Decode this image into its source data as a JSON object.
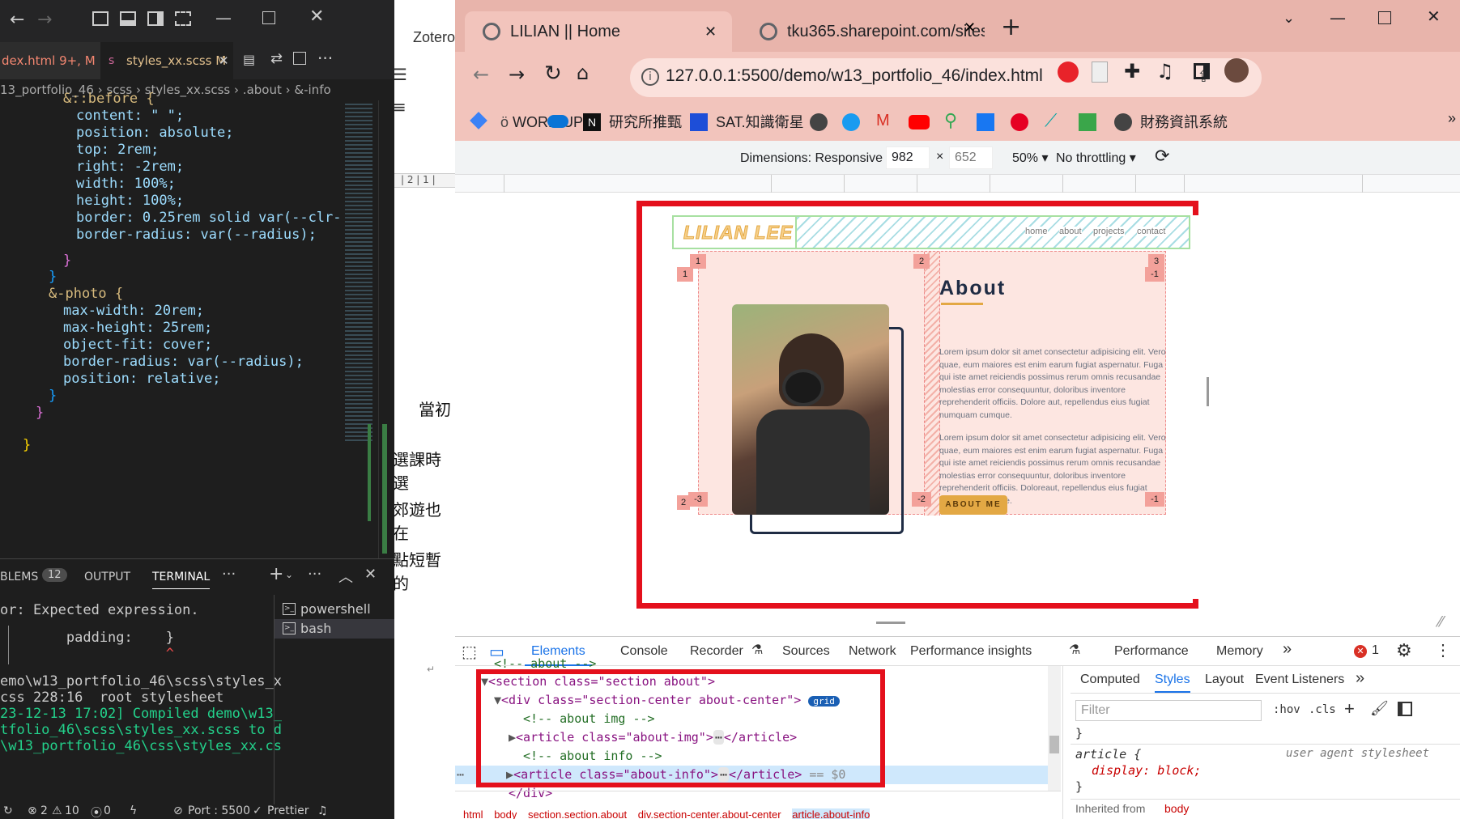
{
  "vscode": {
    "tabs": [
      {
        "label": "dex.html 9+, M"
      },
      {
        "label": "styles_xx.scss M"
      }
    ],
    "breadcrumb": {
      "parts": [
        "13_portfolio_46",
        "scss",
        "styles_xx.scss",
        ".about",
        "&-info"
      ]
    },
    "code_lines": [
      "&::before {",
      "content: \" \";",
      "position: absolute;",
      "top: 2rem;",
      "right: -2rem;",
      "width: 100%;",
      "height: 100%;",
      "border: 0.25rem solid var(--clr-",
      "border-radius: var(--radius);",
      "",
      "}",
      "}",
      "&-photo {",
      "max-width: 20rem;",
      "max-height: 25rem;",
      "object-fit: cover;",
      "border-radius: var(--radius);",
      "position: relative;",
      "}",
      "}",
      "",
      "}"
    ],
    "panel": {
      "tabs": [
        "BLEMS",
        "OUTPUT",
        "TERMINAL"
      ],
      "problems_count": "12",
      "terminal_lines": [
        "or: Expected expression.",
        "",
        "        padding:    }",
        "                    ^",
        "",
        "emo\\w13_portfolio_46\\scss\\styles_x",
        "css 228:16  root stylesheet",
        "23-12-13 17:02] Compiled demo\\w13_",
        "tfolio_46\\scss\\styles_xx.scss to d",
        "\\w13_portfolio_46\\css\\styles_xx.cs"
      ],
      "terminals": [
        "powershell",
        "bash"
      ]
    },
    "status": {
      "errors": "2",
      "warnings": "10",
      "ports": "0",
      "port_label": "Port : 5500",
      "prettier": "Prettier"
    }
  },
  "word": {
    "ribbon_label": "Zotero",
    "ruler_text": "| 2 | 1 |",
    "body_lines": [
      "當初",
      "選課時選",
      "郊遊也在",
      "點短暫的"
    ]
  },
  "chrome": {
    "tabs": [
      {
        "title": "LILIAN || Home"
      },
      {
        "title": "tku365.sharepoint.com/sites/"
      }
    ],
    "url": "127.0.0.1:5500/demo/w13_portfolio_46/index.html",
    "bookmarks": [
      "WORD UP",
      "研究所推甄",
      "SAT.知識衛星",
      "財務資訊系統"
    ],
    "device_toolbar": {
      "dimensions": "Dimensions: Responsive",
      "width": "982",
      "height": "652",
      "zoom": "50%",
      "throttling": "No throttling"
    },
    "page": {
      "logo": "LILIAN LEE",
      "nav": [
        "home",
        "about",
        "projects",
        "contact"
      ],
      "about_title": "About",
      "paragraph1": "Lorem ipsum dolor sit amet consectetur adipisicing elit. Vero quae, eum maiores est enim earum fugiat aspernatur. Fuga qui iste amet reiciendis possimus rerum omnis recusandae molestias error consequuntur, doloribus inventore reprehenderit officiis. Dolore aut, repellendus eius fugiat numquam cumque.",
      "paragraph2": "Lorem ipsum dolor sit amet consectetur adipisicing elit. Vero quae, eum maiores est enim earum fugiat aspernatur. Fuga qui iste amet reiciendis possimus rerum omnis recusandae molestias error consequuntur, doloribus inventore reprehenderit officiis. Doloreaut, repellendus eius fugiat numquam cumque.",
      "button": "ABOUT ME",
      "grid_labels": {
        "top": [
          "1",
          "2",
          "3"
        ],
        "left": "1",
        "right": "-1",
        "bottom": [
          "-3",
          "-2",
          "-1"
        ],
        "bottom_left_outer": "2"
      }
    },
    "devtools": {
      "tabs": [
        "Elements",
        "Console",
        "Recorder",
        "Sources",
        "Network",
        "Performance insights",
        "Performance",
        "Memory"
      ],
      "error_count": "1",
      "dom": {
        "line0": "<!-- about -->",
        "section_open": "<section class=\"section about\">",
        "div_open": "<div class=\"section-center about-center\">",
        "grid_badge": "grid",
        "comment_img": "<!-- about img -->",
        "article_img": "<article class=\"about-img\">",
        "article_close": "</article>",
        "comment_info": "<!-- about info -->",
        "article_info": "<article class=\"about-info\">",
        "selected_marker": "== $0",
        "div_close": "</div>"
      },
      "breadcrumbs": [
        "html",
        "body",
        "section.section.about",
        "div.section-center.about-center",
        "article.about-info"
      ],
      "styles": {
        "tabs": [
          "Computed",
          "Styles",
          "Layout",
          "Event Listeners"
        ],
        "filter_placeholder": "Filter",
        "hov": ":hov",
        "cls": ".cls",
        "brace": "}",
        "rule_selector": "article {",
        "rule_source": "user agent stylesheet",
        "rule_decl": "display: block;",
        "rule_close": "}",
        "inherited_label": "Inherited from",
        "inherited_from": "body"
      }
    }
  },
  "colors": {
    "highlight_red": "#e4101c",
    "accent_gold": "#e3a844",
    "pink_bg": "#fde6e1"
  }
}
